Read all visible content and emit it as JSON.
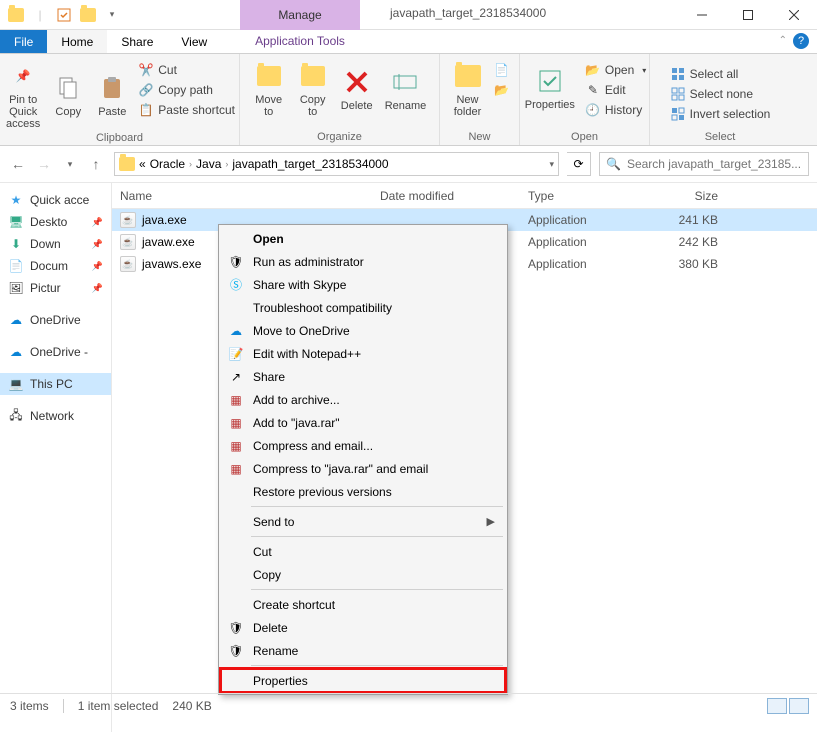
{
  "window": {
    "manage_label": "Manage",
    "title": "javapath_target_2318534000",
    "app_tools": "Application Tools"
  },
  "tabs": {
    "file": "File",
    "home": "Home",
    "share": "Share",
    "view": "View"
  },
  "ribbon": {
    "pin": "Pin to Quick\naccess",
    "copy": "Copy",
    "paste": "Paste",
    "cut": "Cut",
    "copy_path": "Copy path",
    "paste_shortcut": "Paste shortcut",
    "clipboard": "Clipboard",
    "move_to": "Move\nto",
    "copy_to": "Copy\nto",
    "delete": "Delete",
    "rename": "Rename",
    "organize": "Organize",
    "new_folder": "New\nfolder",
    "new": "New",
    "properties": "Properties",
    "open_menu": "Open",
    "edit": "Edit",
    "history": "History",
    "open_group": "Open",
    "select_all": "Select all",
    "select_none": "Select none",
    "invert_selection": "Invert selection",
    "select_group": "Select"
  },
  "breadcrumb": {
    "parts": [
      "Oracle",
      "Java",
      "javapath_target_2318534000"
    ],
    "prefix": "«"
  },
  "search": {
    "placeholder": "Search javapath_target_23185..."
  },
  "sidebar": {
    "items": [
      {
        "label": "Quick acce",
        "icon": "star"
      },
      {
        "label": "Deskto",
        "icon": "desktop"
      },
      {
        "label": "Down",
        "icon": "download"
      },
      {
        "label": "Docum",
        "icon": "doc"
      },
      {
        "label": "Pictur",
        "icon": "pic"
      }
    ],
    "onedrive1": "OneDrive",
    "onedrive2": "OneDrive -",
    "thispc": "This PC",
    "network": "Network"
  },
  "columns": {
    "name": "Name",
    "date": "Date modified",
    "type": "Type",
    "size": "Size"
  },
  "files": [
    {
      "name": "java.exe",
      "type": "Application",
      "size": "241 KB",
      "selected": true
    },
    {
      "name": "javaw.exe",
      "type": "Application",
      "size": "242 KB",
      "selected": false
    },
    {
      "name": "javaws.exe",
      "type": "Application",
      "size": "380 KB",
      "selected": false
    }
  ],
  "context_menu": {
    "open": "Open",
    "run_admin": "Run as administrator",
    "skype": "Share with Skype",
    "troubleshoot": "Troubleshoot compatibility",
    "onedrive": "Move to OneDrive",
    "notepadpp": "Edit with Notepad++",
    "share": "Share",
    "add_archive": "Add to archive...",
    "add_rar": "Add to \"java.rar\"",
    "compress_email": "Compress and email...",
    "compress_rar_email": "Compress to \"java.rar\" and email",
    "restore": "Restore previous versions",
    "send_to": "Send to",
    "cut": "Cut",
    "copy": "Copy",
    "create_shortcut": "Create shortcut",
    "delete": "Delete",
    "rename": "Rename",
    "properties": "Properties"
  },
  "status": {
    "items": "3 items",
    "selected": "1 item selected",
    "size": "240 KB"
  }
}
